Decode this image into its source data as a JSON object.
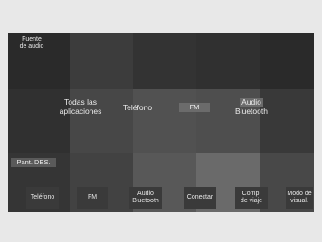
{
  "screen": {
    "top_left_label_line1": "Fuente",
    "top_left_label_line2": "de audio",
    "mid_labels": {
      "apps_line1": "Todas las",
      "apps_line2": "aplicaciones",
      "phone": "Teléfono",
      "fm": "FM",
      "audio_line1": "Audio",
      "audio_line2": "Bluetooth"
    },
    "screen_off_label": "Pant. DES.",
    "bottom_buttons": [
      {
        "line1": "Teléfono",
        "line2": ""
      },
      {
        "line1": "FM",
        "line2": ""
      },
      {
        "line1": "Audio",
        "line2": "Bluetooth"
      },
      {
        "line1": "Conectar",
        "line2": ""
      },
      {
        "line1": "Comp.",
        "line2": "de viaje"
      },
      {
        "line1": "Modo de",
        "line2": "visual."
      }
    ]
  }
}
